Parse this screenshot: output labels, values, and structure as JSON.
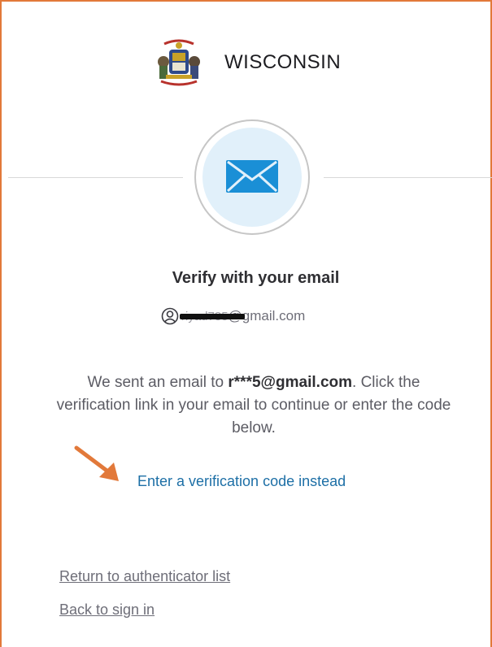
{
  "brand": {
    "name": "WISCONSIN",
    "logo_icon": "wisconsin-state-seal-icon"
  },
  "badge": {
    "icon": "envelope-icon"
  },
  "verify": {
    "title": "Verify with your email",
    "user_email_visible": "@gmail.com",
    "user_email_redacted_hint": "riyad785",
    "user_icon": "user-circle-icon",
    "instructions_prefix": "We sent an email to ",
    "masked_email": "r***5@gmail.com",
    "instructions_suffix": ". Click the verification link in your email to continue or enter the code below.",
    "code_link": "Enter a verification code instead"
  },
  "footer": {
    "return_link": "Return to authenticator list",
    "back_link": "Back to sign in"
  },
  "colors": {
    "frame_accent": "#e2793a",
    "link_blue": "#1d6fa6",
    "badge_fill": "#e1f0fa",
    "envelope_blue": "#1a8fd6"
  }
}
